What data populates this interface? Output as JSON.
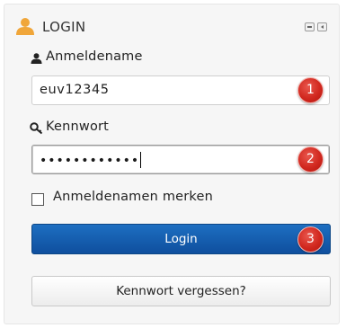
{
  "block": {
    "title": "LOGIN",
    "title_icon": "user-icon",
    "accent_color": "#f0a63a",
    "controls": [
      "minimize-icon",
      "dock-icon"
    ]
  },
  "form": {
    "username_label": "Anmeldename",
    "username_icon": "user-small-icon",
    "username_value": "euv12345",
    "password_label": "Kennwort",
    "password_icon": "key-icon",
    "password_mask": "••••••••••••",
    "remember_label": "Anmeldenamen merken",
    "remember_checked": false,
    "login_button": "Login",
    "forgot_button": "Kennwort vergessen?",
    "login_button_color": "#135aa8"
  },
  "annotations": {
    "badge_color": "#d1281f",
    "badges": [
      "1",
      "2",
      "3"
    ]
  }
}
